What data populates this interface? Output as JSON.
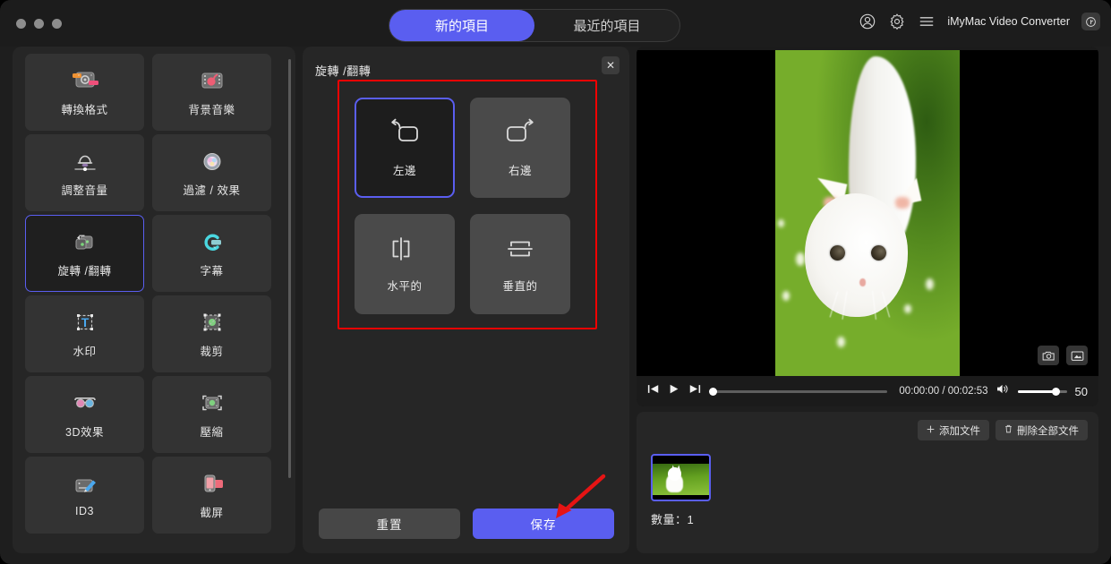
{
  "window": {
    "controls": [
      "close",
      "minimize",
      "maximize"
    ]
  },
  "header": {
    "tabs": [
      {
        "label": "新的項目",
        "active": true
      },
      {
        "label": "最近的項目",
        "active": false
      }
    ],
    "app_name": "iMyMac Video Converter",
    "icons": [
      "account-icon",
      "gear-icon",
      "menu-icon",
      "app-logo-icon"
    ]
  },
  "sidebar": {
    "tools": [
      {
        "label": "轉換格式",
        "icon": "convert-format-icon",
        "selected": false
      },
      {
        "label": "背景音樂",
        "icon": "background-music-icon",
        "selected": false
      },
      {
        "label": "調整音量",
        "icon": "adjust-volume-icon",
        "selected": false
      },
      {
        "label": "過濾 / 效果",
        "icon": "filter-effects-icon",
        "selected": false
      },
      {
        "label": "旋轉 /翻轉",
        "icon": "rotate-flip-icon",
        "selected": true
      },
      {
        "label": "字幕",
        "icon": "subtitle-icon",
        "selected": false
      },
      {
        "label": "水印",
        "icon": "watermark-icon",
        "selected": false
      },
      {
        "label": "裁剪",
        "icon": "crop-icon",
        "selected": false
      },
      {
        "label": "3D效果",
        "icon": "3d-effect-icon",
        "selected": false
      },
      {
        "label": "壓縮",
        "icon": "compress-icon",
        "selected": false
      },
      {
        "label": "ID3",
        "icon": "id3-tag-icon",
        "selected": false
      },
      {
        "label": "截屏",
        "icon": "screenshot-icon",
        "selected": false
      }
    ]
  },
  "panel": {
    "title": "旋轉 /翻轉",
    "close_label": "✕",
    "options": [
      {
        "label": "左邊",
        "icon": "rotate-left-icon",
        "selected": true
      },
      {
        "label": "右邊",
        "icon": "rotate-right-icon",
        "selected": false
      },
      {
        "label": "水平的",
        "icon": "flip-horizontal-icon",
        "selected": false
      },
      {
        "label": "垂直的",
        "icon": "flip-vertical-icon",
        "selected": false
      }
    ],
    "reset_label": "重置",
    "save_label": "保存",
    "accent_color": "#5a5ef0",
    "annotation_color": "#f10000"
  },
  "player": {
    "current_time": "00:00:00",
    "total_time": "00:02:53",
    "time_display": "00:00:00 / 00:02:53",
    "volume": "50",
    "controls": [
      "previous-icon",
      "play-icon",
      "next-icon"
    ],
    "preview_icons": [
      "snapshot-camera-icon",
      "fullscreen-icon"
    ]
  },
  "filelist": {
    "add_file_label": "添加文件",
    "delete_all_label": "刪除全部文件",
    "add_icon": "plus-icon",
    "delete_icon": "trash-icon",
    "count_label": "數量：1",
    "thumbnail_name": "video-thumbnail"
  }
}
